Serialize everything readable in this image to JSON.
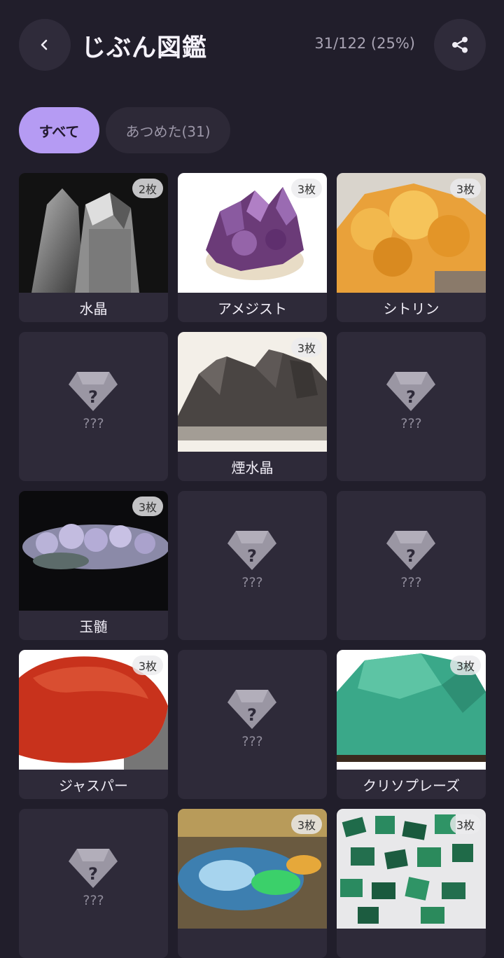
{
  "header": {
    "title": "じぶん図鑑",
    "progress": "31/122 (25%)",
    "back_icon": "chevron-left-icon",
    "share_icon": "share-icon"
  },
  "filters": {
    "all_label": "すべて",
    "collected_label": "あつめた(31)"
  },
  "grid": {
    "items": [
      {
        "name": "水晶",
        "count": "2枚",
        "known": true
      },
      {
        "name": "アメジスト",
        "count": "3枚",
        "known": true
      },
      {
        "name": "シトリン",
        "count": "3枚",
        "known": true
      },
      {
        "name": "???",
        "count": "",
        "known": false
      },
      {
        "name": "煙水晶",
        "count": "3枚",
        "known": true
      },
      {
        "name": "???",
        "count": "",
        "known": false
      },
      {
        "name": "玉髄",
        "count": "3枚",
        "known": true
      },
      {
        "name": "???",
        "count": "",
        "known": false
      },
      {
        "name": "???",
        "count": "",
        "known": false
      },
      {
        "name": "ジャスパー",
        "count": "3枚",
        "known": true
      },
      {
        "name": "???",
        "count": "",
        "known": false
      },
      {
        "name": "クリソプレーズ",
        "count": "3枚",
        "known": true
      },
      {
        "name": "???",
        "count": "",
        "known": false
      },
      {
        "name": "",
        "count": "3枚",
        "known": true
      },
      {
        "name": "",
        "count": "3枚",
        "known": true
      }
    ]
  },
  "colors": {
    "background": "#211e2b",
    "card": "#2e2a39",
    "accent": "#b59bf3"
  }
}
